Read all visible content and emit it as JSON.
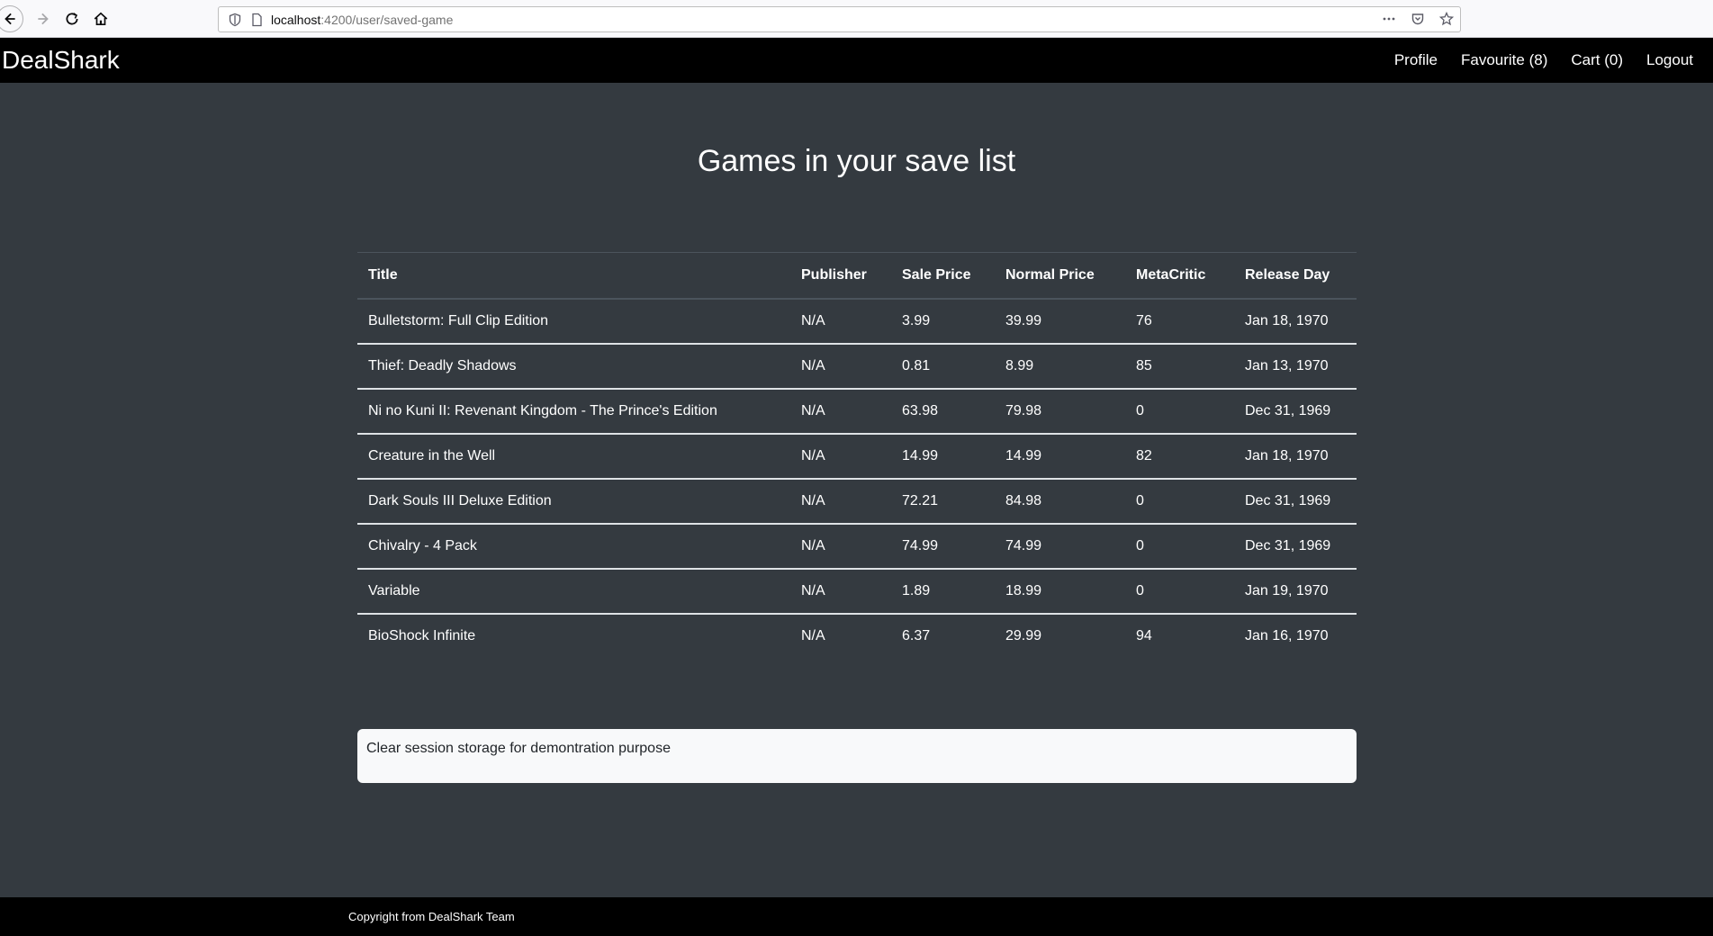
{
  "browser": {
    "url_host": "localhost",
    "url_path": ":4200/user/saved-game"
  },
  "navbar": {
    "brand": "DealShark",
    "links": [
      "Profile",
      "Favourite (8)",
      "Cart (0)",
      "Logout"
    ]
  },
  "main": {
    "title": "Games in your save list",
    "table": {
      "headers": [
        "Title",
        "Publisher",
        "Sale Price",
        "Normal Price",
        "MetaCritic",
        "Release Day"
      ],
      "rows": [
        [
          "Bulletstorm: Full Clip Edition",
          "N/A",
          "3.99",
          "39.99",
          "76",
          "Jan 18, 1970"
        ],
        [
          "Thief: Deadly Shadows",
          "N/A",
          "0.81",
          "8.99",
          "85",
          "Jan 13, 1970"
        ],
        [
          "Ni no Kuni II: Revenant Kingdom - The Prince's Edition",
          "N/A",
          "63.98",
          "79.98",
          "0",
          "Dec 31, 1969"
        ],
        [
          "Creature in the Well",
          "N/A",
          "14.99",
          "14.99",
          "82",
          "Jan 18, 1970"
        ],
        [
          "Dark Souls III Deluxe Edition",
          "N/A",
          "72.21",
          "84.98",
          "0",
          "Dec 31, 1969"
        ],
        [
          "Chivalry - 4 Pack",
          "N/A",
          "74.99",
          "74.99",
          "0",
          "Dec 31, 1969"
        ],
        [
          "Variable",
          "N/A",
          "1.89",
          "18.99",
          "0",
          "Jan 19, 1970"
        ],
        [
          "BioShock Infinite",
          "N/A",
          "6.37",
          "29.99",
          "94",
          "Jan 16, 1970"
        ]
      ]
    },
    "clear_button": "Clear session storage for demontration purpose"
  },
  "footer": {
    "text": "Copyright from DealShark Team"
  }
}
